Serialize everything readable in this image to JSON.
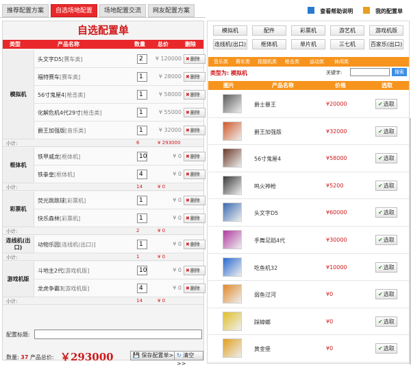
{
  "tabs": [
    "推荐配置方案",
    "自选场地配置",
    "场地配置交流",
    "网友配置方案"
  ],
  "config": {
    "title": "自选配置单",
    "headers": {
      "type": "类型",
      "name": "产品名称",
      "qty": "数量",
      "total": "总价",
      "del": "删除"
    },
    "delete_label": "删除",
    "groups": [
      {
        "category": "模拟机",
        "items": [
          {
            "name": "头文字D5",
            "tag": "[赛车类]",
            "qty": "2",
            "price": "¥ 120000"
          },
          {
            "name": "福特赛车",
            "tag": "[赛车类]",
            "qty": "1",
            "price": "¥ 28000"
          },
          {
            "name": "56寸鬼屋4",
            "tag": "[枪击类]",
            "qty": "1",
            "price": "¥ 58000"
          },
          {
            "name": "化解危机4代29寸",
            "tag": "[枪击类]",
            "qty": "1",
            "price": "¥ 55000"
          },
          {
            "name": "爵王加强版",
            "tag": "[音乐类]",
            "qty": "1",
            "price": "¥ 32000"
          }
        ],
        "subtotal_label": "小计:",
        "subtotal_count": "6",
        "subtotal_amount": "¥ 293000"
      },
      {
        "category": "框体机",
        "items": [
          {
            "name": "铁甲威龙",
            "tag": "[框体机]",
            "qty": "10",
            "price": "¥ 0"
          },
          {
            "name": "铁拳皇",
            "tag": "[框体机]",
            "qty": "4",
            "price": "¥ 0"
          }
        ],
        "subtotal_label": "小计:",
        "subtotal_count": "14",
        "subtotal_amount": "¥ 0"
      },
      {
        "category": "彩票机",
        "items": [
          {
            "name": "荧光跳跳球",
            "tag": "[彩票机]",
            "qty": "1",
            "price": "¥ 0"
          },
          {
            "name": "快乐森林",
            "tag": "[彩票机]",
            "qty": "1",
            "price": "¥ 0"
          }
        ],
        "subtotal_label": "小计:",
        "subtotal_count": "2",
        "subtotal_amount": "¥ 0"
      },
      {
        "category": "连线机(出口)",
        "items": [
          {
            "name": "动物乐园",
            "tag": "[连线机(出口)]",
            "qty": "1",
            "price": "¥ 0"
          }
        ],
        "subtotal_label": "小计:",
        "subtotal_count": "1",
        "subtotal_amount": "¥ 0"
      },
      {
        "category": "游戏机版",
        "items": [
          {
            "name": "斗地主2代",
            "tag": "[游戏机版]",
            "qty": "10",
            "price": "¥ 0"
          },
          {
            "name": "龙虎争霸3",
            "tag": "[游戏机版]",
            "qty": "4",
            "price": "¥ 0"
          }
        ],
        "subtotal_label": "小计:",
        "subtotal_count": "14",
        "subtotal_amount": "¥ 0"
      }
    ],
    "config_title_label": "配置标题:",
    "count_label": "数量:",
    "count_value": "37",
    "total_label": "产品总价:",
    "total_value": "￥293000",
    "save_button": "保存配置单>>",
    "clear_button": "清空>>"
  },
  "toplinks": {
    "help": "查看帮助说明",
    "mine": "我的配置单"
  },
  "categories": [
    "模拟机",
    "配件",
    "彩票机",
    "游艺机",
    "游戏机版",
    "连线机(出口)",
    "框体机",
    "单片机",
    "三七机",
    "百家乐(出口)"
  ],
  "subcats": [
    "音乐类",
    "赛车类",
    "摇摆机类",
    "枪击类",
    "运动类",
    "休闲类"
  ],
  "filter": {
    "type_label": "类型为: 模拟机",
    "keyword_label": "关键字:",
    "search_button": "搜索"
  },
  "product_headers": {
    "pic": "图片",
    "name": "产品名称",
    "price": "价格",
    "pick": "选取"
  },
  "pick_label": "选取",
  "products": [
    {
      "name": "爵士暴王",
      "price": "¥20000",
      "color": "#5a5a5a"
    },
    {
      "name": "爵王加强版",
      "price": "¥32000",
      "color": "#d05a2a"
    },
    {
      "name": "56寸鬼屋4",
      "price": "¥58000",
      "color": "#6a3a2a"
    },
    {
      "name": "鸣火神枪",
      "price": "¥5200",
      "color": "#3a3a3a"
    },
    {
      "name": "头文字D5",
      "price": "¥60000",
      "color": "#3a6ab0"
    },
    {
      "name": "手舞足蹈4代",
      "price": "¥30000",
      "color": "#b03aa0"
    },
    {
      "name": "吃鱼机32",
      "price": "¥10000",
      "color": "#2a6ad0"
    },
    {
      "name": "弱鱼过河",
      "price": "¥0",
      "color": "#e08a2a"
    },
    {
      "name": "踩蟑螂",
      "price": "¥0",
      "color": "#e0c02a"
    },
    {
      "name": "黄金堡",
      "price": "¥0",
      "color": "#e0a020"
    }
  ]
}
